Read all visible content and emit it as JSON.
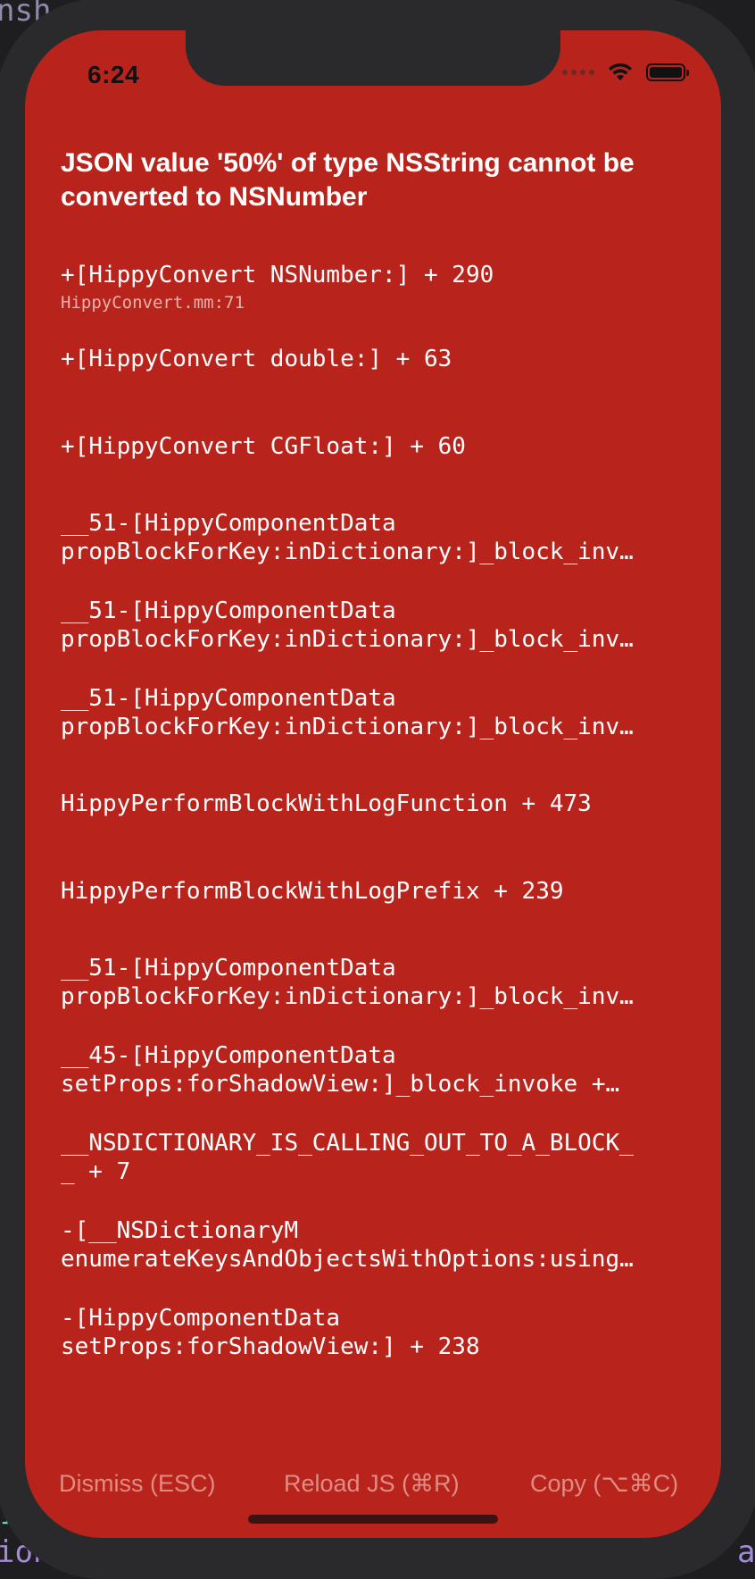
{
  "backdrop": {
    "top_left_text": "nsh",
    "bottom_left_text": "ion",
    "bottom_right_text": "an",
    "side_left_text": "I"
  },
  "status_bar": {
    "time": "6:24",
    "icons": [
      "signal-dots-icon",
      "wifi-icon",
      "battery-icon"
    ]
  },
  "redbox": {
    "background_color": "#b8241c",
    "title": "JSON value '50%' of type NSString cannot be converted to NSNumber",
    "frames": [
      {
        "lines": [
          "+[HippyConvert NSNumber:] + 290"
        ],
        "file": "HippyConvert.mm:71"
      },
      {
        "lines": [
          "+[HippyConvert double:] + 63"
        ],
        "file": ""
      },
      {
        "lines": [
          "+[HippyConvert CGFloat:] + 60"
        ],
        "file": ""
      },
      {
        "lines": [
          "__51-[HippyComponentData",
          "propBlockForKey:inDictionary:]_block_inv…"
        ],
        "file": ""
      },
      {
        "lines": [
          "__51-[HippyComponentData",
          "propBlockForKey:inDictionary:]_block_inv…"
        ],
        "file": ""
      },
      {
        "lines": [
          "__51-[HippyComponentData",
          "propBlockForKey:inDictionary:]_block_inv…"
        ],
        "file": ""
      },
      {
        "lines": [
          "HippyPerformBlockWithLogFunction + 473"
        ],
        "file": ""
      },
      {
        "lines": [
          "HippyPerformBlockWithLogPrefix + 239"
        ],
        "file": ""
      },
      {
        "lines": [
          "__51-[HippyComponentData",
          "propBlockForKey:inDictionary:]_block_inv…"
        ],
        "file": ""
      },
      {
        "lines": [
          "__45-[HippyComponentData",
          "setProps:forShadowView:]_block_invoke +…"
        ],
        "file": ""
      },
      {
        "lines": [
          "__NSDICTIONARY_IS_CALLING_OUT_TO_A_BLOCK_",
          "_ + 7"
        ],
        "file": ""
      },
      {
        "lines": [
          "-[__NSDictionaryM",
          "enumerateKeysAndObjectsWithOptions:using…"
        ],
        "file": ""
      },
      {
        "lines": [
          "-[HippyComponentData",
          "setProps:forShadowView:] + 238"
        ],
        "file": ""
      }
    ]
  },
  "actions": {
    "dismiss_label": "Dismiss (ESC)",
    "reload_label": "Reload JS (⌘R)",
    "copy_label": "Copy (⌥⌘C)"
  }
}
